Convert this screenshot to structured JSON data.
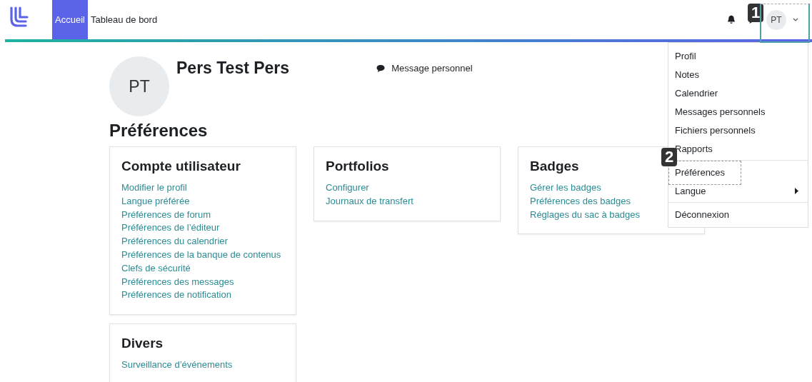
{
  "nav": {
    "tabs": [
      {
        "label": "Accueil",
        "selected": true
      },
      {
        "label": "Tableau de bord",
        "selected": false
      }
    ],
    "avatar": "PT"
  },
  "profile": {
    "avatar": "PT",
    "name": "Pers Test Pers",
    "message_link": "Message personnel"
  },
  "page_title": "Préférences",
  "cards": [
    {
      "title": "Compte utilisateur",
      "links": [
        "Modifier le profil",
        "Langue préférée",
        "Préférences de forum",
        "Préférences de l’éditeur",
        "Préférences du calendrier",
        "Préférences de la banque de contenus",
        "Clefs de sécurité",
        "Préférences des messages",
        "Préférences de notification"
      ]
    },
    {
      "title": "Portfolios",
      "links": [
        "Configurer",
        "Journaux de transfert"
      ]
    },
    {
      "title": "Badges",
      "links": [
        "Gérer les badges",
        "Préférences des badges",
        "Réglages du sac à badges"
      ]
    },
    {
      "title": "Divers",
      "links": [
        "Surveillance d’événements"
      ]
    }
  ],
  "user_menu": {
    "groups": [
      [
        {
          "label": "Profil",
          "submenu": false
        },
        {
          "label": "Notes",
          "submenu": false
        },
        {
          "label": "Calendrier",
          "submenu": false
        },
        {
          "label": "Messages personnels",
          "submenu": false
        },
        {
          "label": "Fichiers personnels",
          "submenu": false
        },
        {
          "label": "Rapports",
          "submenu": false
        }
      ],
      [
        {
          "label": "Préférences",
          "submenu": false
        },
        {
          "label": "Langue",
          "submenu": true
        }
      ],
      [
        {
          "label": "Déconnexion",
          "submenu": false
        }
      ]
    ]
  },
  "callouts": [
    "1",
    "2"
  ]
}
